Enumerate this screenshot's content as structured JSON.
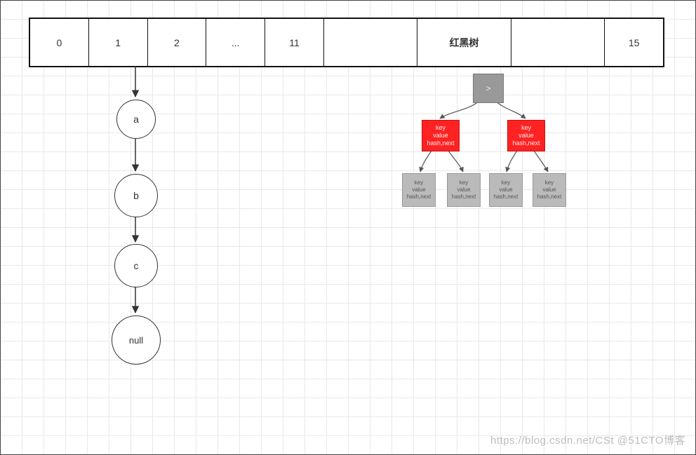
{
  "array_cells": {
    "c0": "0",
    "c1": "1",
    "c2": "2",
    "c3": "...",
    "c4": "11",
    "c5": "",
    "c6": "红黑树",
    "c7": "",
    "c8": "15"
  },
  "linked_list": {
    "n0": "a",
    "n1": "b",
    "n2": "c",
    "n3": "null"
  },
  "rbtree": {
    "root": ">",
    "red_lines": {
      "l1": "key",
      "l2": "value",
      "l3": "hash,next"
    },
    "leaf_lines": {
      "l1": "key",
      "l2": "value",
      "l3": "hash,next"
    }
  },
  "watermark": "https://blog.csdn.net/CSt @51CTO博客"
}
